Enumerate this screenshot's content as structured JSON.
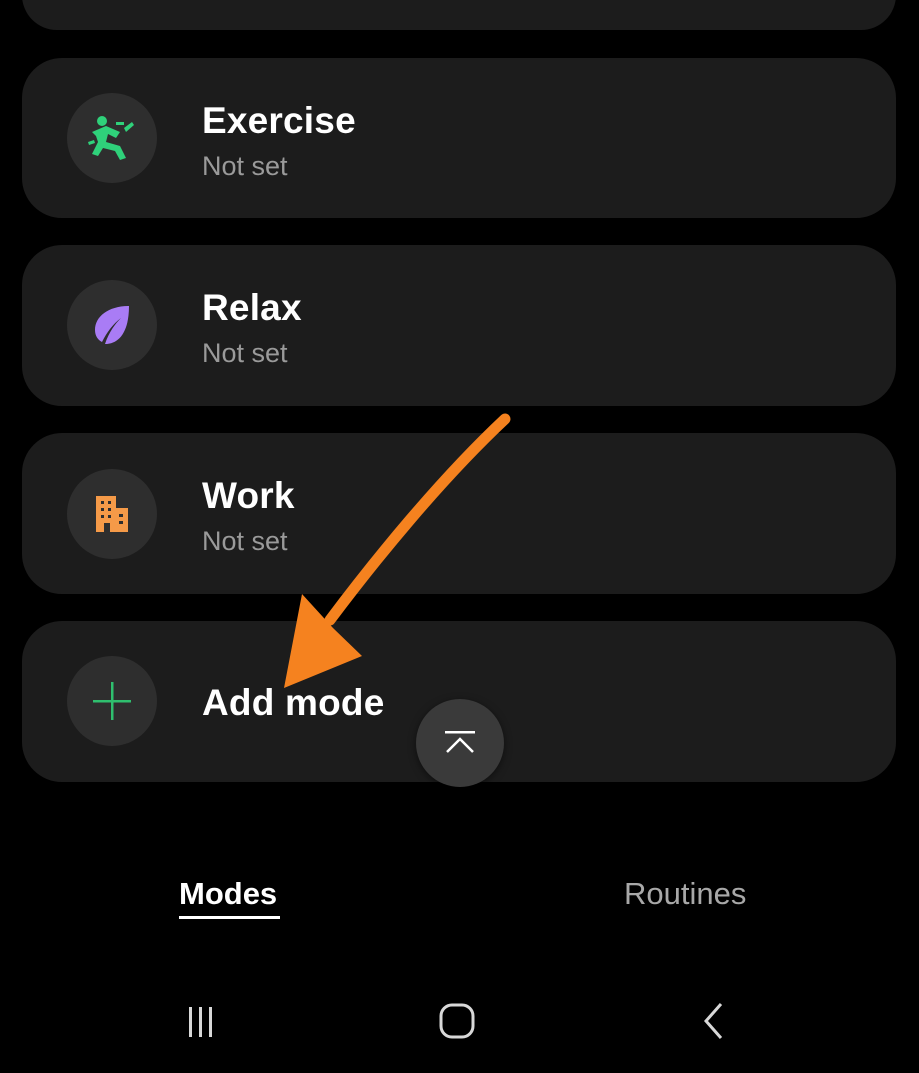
{
  "modes": [
    {
      "title": "Exercise",
      "status": "Not set",
      "icon": "exercise-icon",
      "icon_color": "#2fd17a"
    },
    {
      "title": "Relax",
      "status": "Not set",
      "icon": "leaf-icon",
      "icon_color": "#a97cf5"
    },
    {
      "title": "Work",
      "status": "Not set",
      "icon": "building-icon",
      "icon_color": "#f59a48"
    }
  ],
  "add_mode": {
    "label": "Add mode",
    "icon": "plus-icon",
    "icon_color": "#2fbf6e"
  },
  "scroll_top": {
    "icon": "scroll-to-top-icon"
  },
  "tabs": [
    {
      "label": "Modes",
      "selected": true
    },
    {
      "label": "Routines",
      "selected": false
    }
  ],
  "nav_bar": {
    "icons": [
      "recent-apps-icon",
      "home-icon",
      "back-icon"
    ]
  },
  "annotation": {
    "arrow_color": "#f5821f"
  },
  "colors": {
    "background": "#000000",
    "card": "#1c1c1c",
    "icon_bg": "#2e2e2e"
  }
}
